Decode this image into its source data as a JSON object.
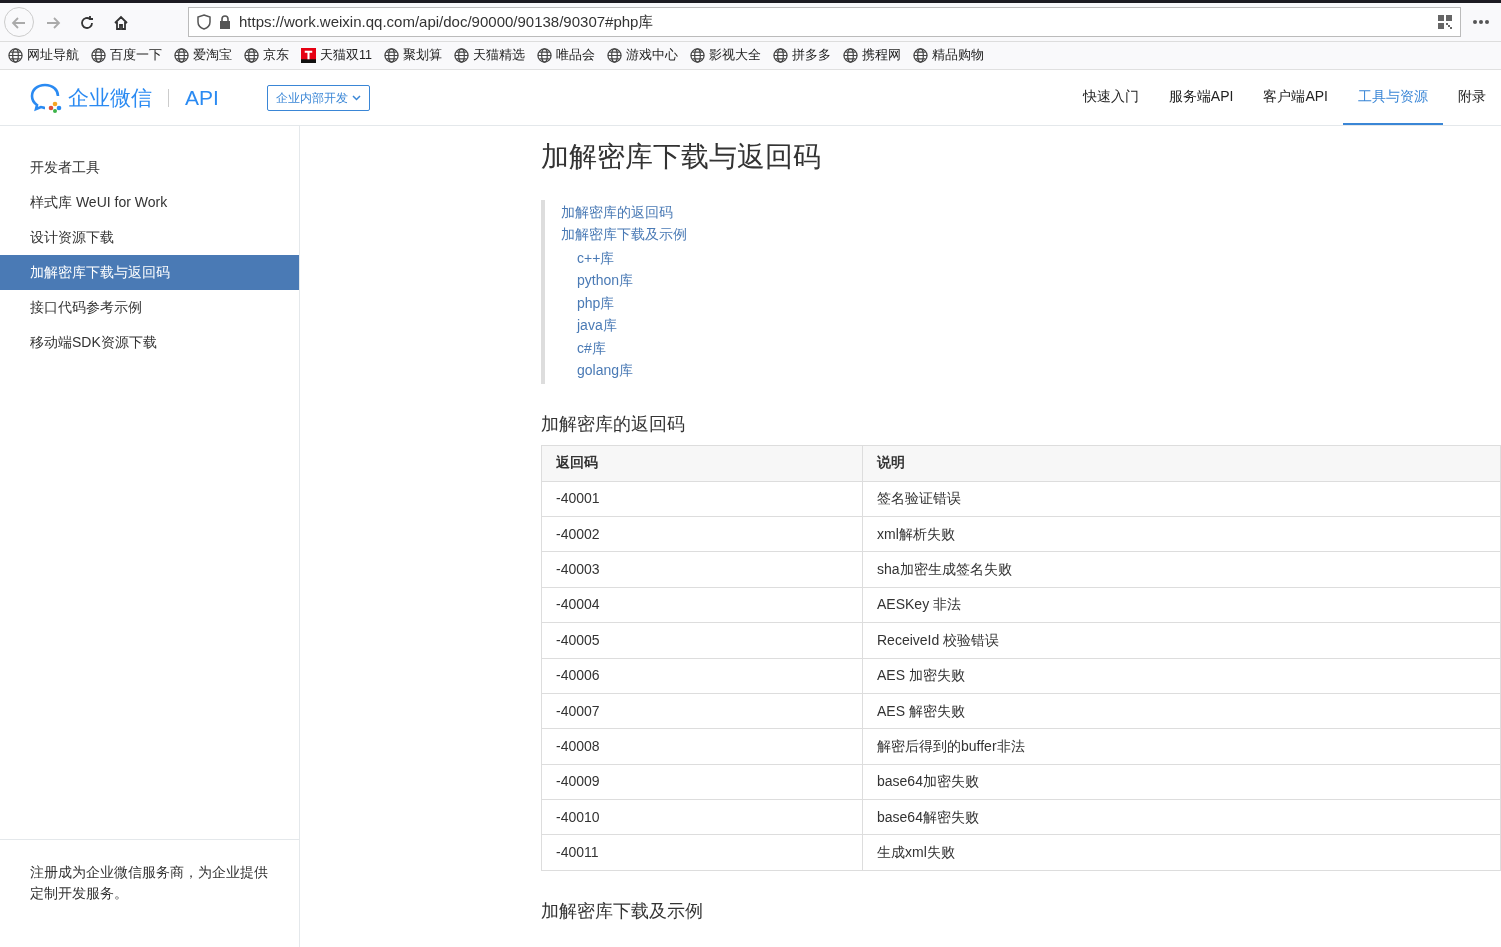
{
  "browser": {
    "url": "https://work.weixin.qq.com/api/doc/90000/90138/90307#php库"
  },
  "bookmarks": [
    {
      "label": "网址导航",
      "kind": "globe"
    },
    {
      "label": "百度一下",
      "kind": "globe"
    },
    {
      "label": "爱淘宝",
      "kind": "globe"
    },
    {
      "label": "京东",
      "kind": "globe"
    },
    {
      "label": "天猫双11",
      "kind": "tmall"
    },
    {
      "label": "聚划算",
      "kind": "globe"
    },
    {
      "label": "天猫精选",
      "kind": "globe"
    },
    {
      "label": "唯品会",
      "kind": "globe"
    },
    {
      "label": "游戏中心",
      "kind": "globe"
    },
    {
      "label": "影视大全",
      "kind": "globe"
    },
    {
      "label": "拼多多",
      "kind": "globe"
    },
    {
      "label": "携程网",
      "kind": "globe"
    },
    {
      "label": "精品购物",
      "kind": "globe"
    }
  ],
  "header": {
    "logo": "企业微信",
    "api": "API",
    "dropdown": "企业内部开发",
    "nav": [
      {
        "label": "快速入门",
        "selected": false
      },
      {
        "label": "服务端API",
        "selected": false
      },
      {
        "label": "客户端API",
        "selected": false
      },
      {
        "label": "工具与资源",
        "selected": true
      },
      {
        "label": "附录",
        "selected": false
      }
    ]
  },
  "sidebar": {
    "items": [
      {
        "label": "开发者工具",
        "selected": false
      },
      {
        "label": "样式库 WeUI for Work",
        "selected": false
      },
      {
        "label": "设计资源下载",
        "selected": false
      },
      {
        "label": "加解密库下载与返回码",
        "selected": true
      },
      {
        "label": "接口代码参考示例",
        "selected": false
      },
      {
        "label": "移动端SDK资源下载",
        "selected": false
      }
    ],
    "footer": "注册成为企业微信服务商，为企业提供定制开发服务。"
  },
  "page": {
    "title": "加解密库下载与返回码",
    "toc": [
      {
        "label": "加解密库的返回码"
      },
      {
        "label": "加解密库下载及示例",
        "children": [
          {
            "label": "c++库"
          },
          {
            "label": "python库"
          },
          {
            "label": "php库"
          },
          {
            "label": "java库"
          },
          {
            "label": "c#库"
          },
          {
            "label": "golang库"
          }
        ]
      }
    ],
    "section_1": "加解密库的返回码",
    "table": {
      "columns": [
        "返回码",
        "说明"
      ],
      "rows": [
        [
          "-40001",
          "签名验证错误"
        ],
        [
          "-40002",
          "xml解析失败"
        ],
        [
          "-40003",
          "sha加密生成签名失败"
        ],
        [
          "-40004",
          "AESKey 非法"
        ],
        [
          "-40005",
          "ReceiveId 校验错误"
        ],
        [
          "-40006",
          "AES 加密失败"
        ],
        [
          "-40007",
          "AES 解密失败"
        ],
        [
          "-40008",
          "解密后得到的buffer非法"
        ],
        [
          "-40009",
          "base64加密失败"
        ],
        [
          "-40010",
          "base64解密失败"
        ],
        [
          "-40011",
          "生成xml失败"
        ]
      ]
    },
    "section_2": "加解密库下载及示例"
  }
}
